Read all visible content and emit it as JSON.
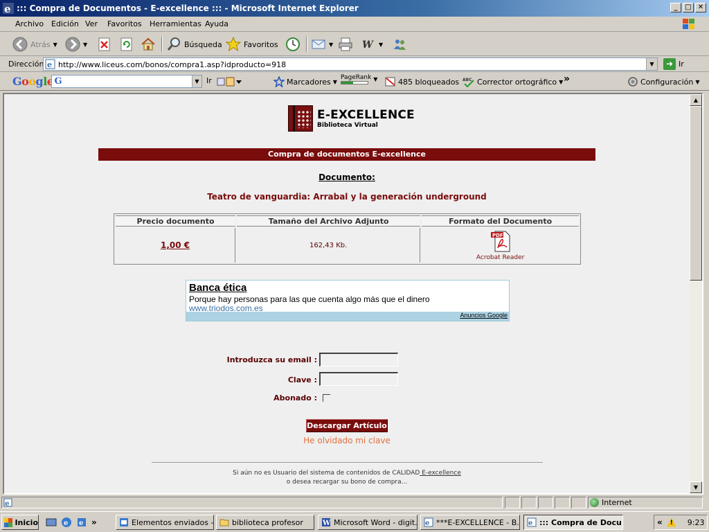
{
  "window": {
    "title": "::: Compra de Documentos - E-excellence ::: - Microsoft Internet Explorer",
    "min": "_",
    "max": "□",
    "close": "✕"
  },
  "menu": [
    "Archivo",
    "Edición",
    "Ver",
    "Favoritos",
    "Herramientas",
    "Ayuda"
  ],
  "toolbar": {
    "back": "Atrás",
    "search": "Búsqueda",
    "favorites": "Favoritos"
  },
  "address": {
    "label": "Dirección",
    "url": "http://www.liceus.com/bonos/compra1.asp?idproducto=918",
    "go": "Ir"
  },
  "google": {
    "logo": "Google",
    "go": "Ir",
    "bookmarks": "Marcadores",
    "pagerank": "PageRank",
    "blocked": "485 bloqueados",
    "spell": "Corrector ortográfico",
    "more": "»",
    "settings": "Configuración"
  },
  "page": {
    "logo_title": "E-EXCELLENCE",
    "logo_subtitle": "Biblioteca Virtual",
    "section_title": "Compra de documentos E-excellence",
    "doc_label": "Documento:",
    "doc_title": "Teatro de vanguardia: Arrabal y la generación underground",
    "table": {
      "headers": [
        "Precio documento",
        "Tamaño del Archivo Adjunto",
        "Formato del Documento"
      ],
      "price": "1,00 €",
      "size": "162,43 Kb.",
      "format_badge": "PDF",
      "format": "Acrobat Reader"
    },
    "ad": {
      "title": "Banca ética",
      "text": "Porque hay personas para las que cuenta algo más que el dinero",
      "link": "www.triodos.com.es",
      "footer": "Anuncios Google"
    },
    "form": {
      "email_label": "Introduzca su email :",
      "password_label": "Clave :",
      "subscriber_label": "Abonado :",
      "submit": "Descargar Artículo",
      "forgot": "He olvidado mi clave"
    },
    "footer": {
      "line1_text": "Si aún no es Usuario del sistema de contenidos de CALIDAD",
      "line1_link": " E-excellence",
      "line2": "o desea recargar su bono de compra..."
    }
  },
  "status": {
    "zone": "Internet"
  },
  "taskbar": {
    "start": "Inicio",
    "more": "»",
    "tasks": [
      "Elementos enviados -...",
      "biblioteca profesor",
      "Microsoft Word - digit...",
      "***E-EXCELLENCE - B...",
      "::: Compra de Docu..."
    ],
    "tray_more": "«",
    "clock": "9:23"
  }
}
